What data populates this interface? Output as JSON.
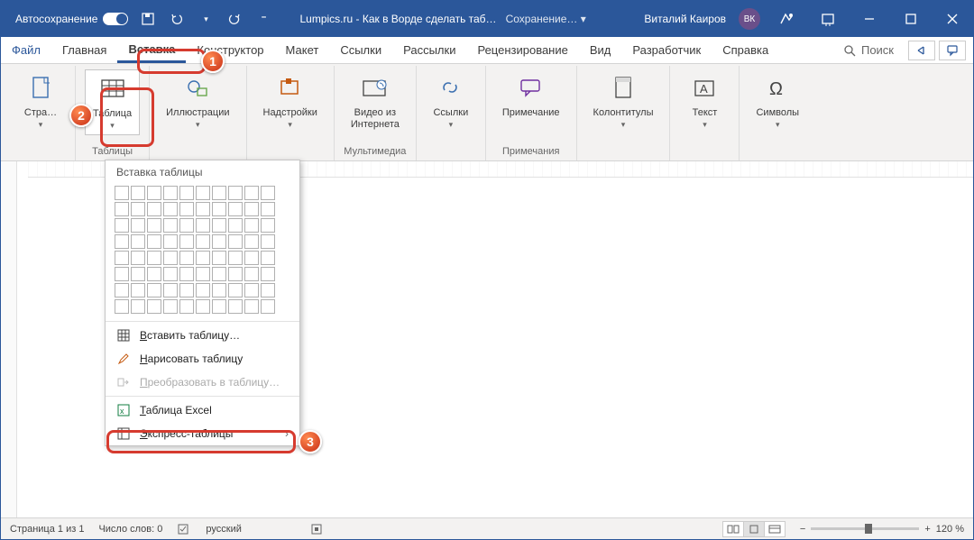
{
  "titlebar": {
    "autosave": "Автосохранение",
    "title": "Lumpics.ru - Как в Ворде сделать таб…",
    "saving": "Сохранение… ▾",
    "user": "Виталий Каиров",
    "avatar": "ВК"
  },
  "tabs": {
    "file": "Файл",
    "home": "Главная",
    "insert": "Вставка",
    "design": "Конструктор",
    "layout": "Макет",
    "references": "Ссылки",
    "mailings": "Рассылки",
    "review": "Рецензирование",
    "view": "Вид",
    "developer": "Разработчик",
    "help": "Справка",
    "search": "Поиск"
  },
  "ribbon": {
    "pages": "Стра…",
    "table": "Таблица",
    "illustrations": "Иллюстрации",
    "addins": "Надстройки",
    "onlinevideo": "Видео из\nИнтернета",
    "links": "Ссылки",
    "comment": "Примечание",
    "headerfooter": "Колонтитулы",
    "text": "Текст",
    "symbols": "Символы",
    "g_tables": "Таблицы",
    "g_media": "Мультимедиа",
    "g_comments": "Примечания"
  },
  "dropdown": {
    "title": "Вставка таблицы",
    "insert": "Вставить таблицу…",
    "draw": "Нарисовать таблицу",
    "convert": "Преобразовать в таблицу…",
    "excel": "Таблица Excel",
    "quick": "Экспресс-таблицы"
  },
  "status": {
    "page": "Страница 1 из 1",
    "words": "Число слов: 0",
    "lang": "русский",
    "zoom": "120 %"
  },
  "badges": {
    "b1": "1",
    "b2": "2",
    "b3": "3"
  }
}
